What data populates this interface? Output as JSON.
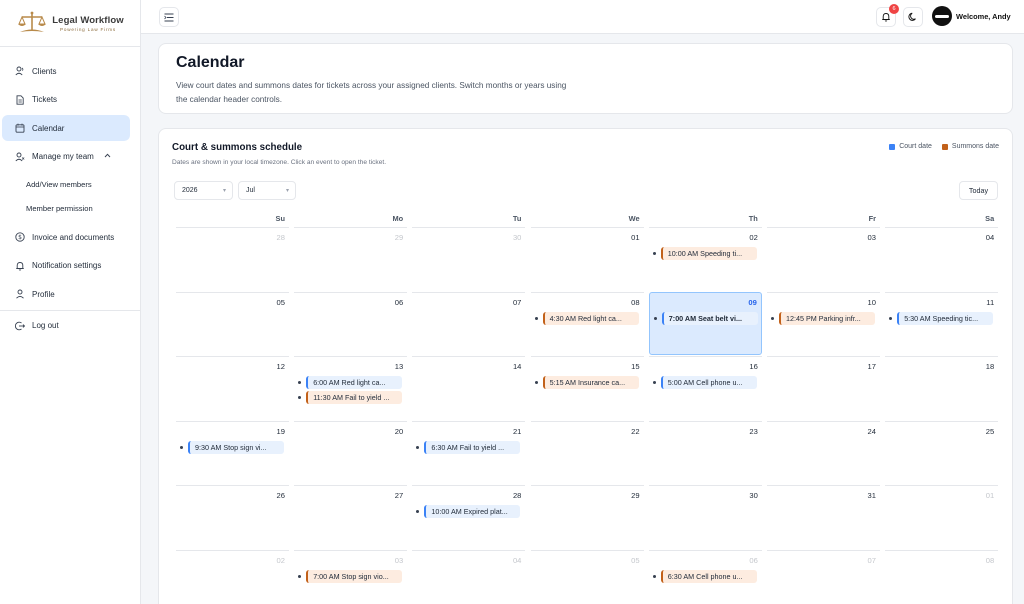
{
  "brand": {
    "title": "Legal Workflow",
    "subtitle": "Powering Law Firms"
  },
  "sidebar": {
    "items": [
      {
        "label": "Clients",
        "icon": "users-icon"
      },
      {
        "label": "Tickets",
        "icon": "document-icon"
      },
      {
        "label": "Calendar",
        "icon": "calendar-icon",
        "active": true
      },
      {
        "label": "Manage my team",
        "icon": "team-icon"
      }
    ],
    "sub_items": [
      "Add/View members",
      "Member permission"
    ],
    "items2": [
      {
        "label": "Invoice and documents",
        "icon": "dollar-icon"
      },
      {
        "label": "Notification settings",
        "icon": "bell-icon"
      },
      {
        "label": "Profile",
        "icon": "user-icon"
      }
    ],
    "logout": "Log out"
  },
  "topbar": {
    "notification_count": "6",
    "welcome": "Welcome, Andy"
  },
  "header": {
    "title": "Calendar",
    "description": "View court dates and summons dates for tickets across your assigned clients. Switch months or years using the calendar header controls."
  },
  "calendar": {
    "title": "Court & summons schedule",
    "subtitle": "Dates are shown in your local timezone. Click an event to open the ticket.",
    "legend": {
      "court": "Court date",
      "summons": "Summons date"
    },
    "year": "2026",
    "month": "Jul",
    "today_label": "Today",
    "weekdays": [
      "Su",
      "Mo",
      "Tu",
      "We",
      "Th",
      "Fr",
      "Sa"
    ],
    "weeks": [
      [
        {
          "d": "28",
          "m": true
        },
        {
          "d": "29",
          "m": true
        },
        {
          "d": "30",
          "m": true
        },
        {
          "d": "01"
        },
        {
          "d": "02",
          "events": [
            {
              "t": "10:00 AM Speeding ti...",
              "k": "summons"
            }
          ]
        },
        {
          "d": "03"
        },
        {
          "d": "04"
        }
      ],
      [
        {
          "d": "05"
        },
        {
          "d": "06"
        },
        {
          "d": "07"
        },
        {
          "d": "08",
          "events": [
            {
              "t": "4:30 AM Red light ca...",
              "k": "summons"
            }
          ]
        },
        {
          "d": "09",
          "today": true,
          "events": [
            {
              "t": "7:00 AM Seat belt vi...",
              "k": "court",
              "b": true
            }
          ]
        },
        {
          "d": "10",
          "events": [
            {
              "t": "12:45 PM Parking infr...",
              "k": "summons"
            }
          ]
        },
        {
          "d": "11",
          "events": [
            {
              "t": "5:30 AM Speeding tic...",
              "k": "court"
            }
          ]
        }
      ],
      [
        {
          "d": "12"
        },
        {
          "d": "13",
          "events": [
            {
              "t": "6:00 AM Red light ca...",
              "k": "court"
            },
            {
              "t": "11:30 AM Fail to yield ...",
              "k": "summons"
            }
          ]
        },
        {
          "d": "14"
        },
        {
          "d": "15",
          "events": [
            {
              "t": "5:15 AM Insurance ca...",
              "k": "summons"
            }
          ]
        },
        {
          "d": "16",
          "events": [
            {
              "t": "5:00 AM Cell phone u...",
              "k": "court"
            }
          ]
        },
        {
          "d": "17"
        },
        {
          "d": "18"
        }
      ],
      [
        {
          "d": "19",
          "events": [
            {
              "t": "9:30 AM Stop sign vi...",
              "k": "court"
            }
          ]
        },
        {
          "d": "20"
        },
        {
          "d": "21",
          "events": [
            {
              "t": "6:30 AM Fail to yield ...",
              "k": "court"
            }
          ]
        },
        {
          "d": "22"
        },
        {
          "d": "23"
        },
        {
          "d": "24"
        },
        {
          "d": "25"
        }
      ],
      [
        {
          "d": "26"
        },
        {
          "d": "27"
        },
        {
          "d": "28",
          "events": [
            {
              "t": "10:00 AM Expired plat...",
              "k": "court"
            }
          ]
        },
        {
          "d": "29"
        },
        {
          "d": "30"
        },
        {
          "d": "31"
        },
        {
          "d": "01",
          "m": true
        }
      ],
      [
        {
          "d": "02",
          "m": true
        },
        {
          "d": "03",
          "m": true,
          "events": [
            {
              "t": "7:00 AM Stop sign vio...",
              "k": "summons"
            }
          ]
        },
        {
          "d": "04",
          "m": true
        },
        {
          "d": "05",
          "m": true
        },
        {
          "d": "06",
          "m": true,
          "events": [
            {
              "t": "6:30 AM Cell phone u...",
              "k": "summons"
            }
          ]
        },
        {
          "d": "07",
          "m": true
        },
        {
          "d": "08",
          "m": true
        }
      ]
    ]
  },
  "colors": {
    "court": "#3b82f6",
    "summons": "#c2611a",
    "active_bg": "#dbeafe"
  }
}
